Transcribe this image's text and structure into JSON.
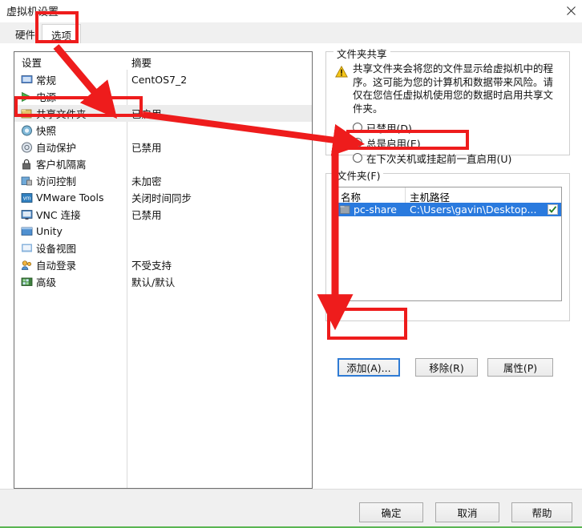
{
  "window": {
    "title": "虚拟机设置",
    "close_label": "✕"
  },
  "tabs": [
    {
      "label": "硬件",
      "active": false
    },
    {
      "label": "选项",
      "active": true
    }
  ],
  "settings_list": {
    "header": {
      "name": "设置",
      "summary": "摘要"
    },
    "rows": [
      {
        "label": "常规",
        "summary": "CentOS7_2",
        "icon": "monitor-icon",
        "selected": false
      },
      {
        "label": "电源",
        "summary": "",
        "icon": "play-icon",
        "selected": false
      },
      {
        "label": "共享文件夹",
        "summary": "已启用",
        "icon": "folder-icon",
        "selected": true
      },
      {
        "label": "快照",
        "summary": "",
        "icon": "camera-icon",
        "selected": false
      },
      {
        "label": "自动保护",
        "summary": "已禁用",
        "icon": "shield-circle-icon",
        "selected": false
      },
      {
        "label": "客户机隔离",
        "summary": "",
        "icon": "lock-icon",
        "selected": false
      },
      {
        "label": "访问控制",
        "summary": "未加密",
        "icon": "key-lock-icon",
        "selected": false
      },
      {
        "label": "VMware Tools",
        "summary": "关闭时间同步",
        "icon": "vm-icon",
        "selected": false
      },
      {
        "label": "VNC 连接",
        "summary": "已禁用",
        "icon": "display-icon",
        "selected": false
      },
      {
        "label": "Unity",
        "summary": "",
        "icon": "window-icon",
        "selected": false
      },
      {
        "label": "设备视图",
        "summary": "",
        "icon": "device-icon",
        "selected": false
      },
      {
        "label": "自动登录",
        "summary": "不受支持",
        "icon": "users-icon",
        "selected": false
      },
      {
        "label": "高级",
        "summary": "默认/默认",
        "icon": "grid-icon",
        "selected": false
      }
    ]
  },
  "folder_sharing": {
    "group_title": "文件夹共享",
    "warning_icon": "warning-triangle-icon",
    "warning_text": "共享文件夹会将您的文件显示给虚拟机中的程序。这可能为您的计算机和数据带来风险。请仅在您信任虚拟机使用您的数据时启用共享文件夹。",
    "options": [
      {
        "label": "已禁用(D)",
        "checked": false
      },
      {
        "label": "总是启用(E)",
        "checked": true
      },
      {
        "label": "在下次关机或挂起前一直启用(U)",
        "checked": false
      }
    ]
  },
  "folders": {
    "group_title": "文件夹(F)",
    "columns": [
      "名称",
      "主机路径"
    ],
    "rows": [
      {
        "name": "pc-share",
        "host_path": "C:\\Users\\gavin\\Desktop...",
        "enabled": true,
        "selected": true,
        "icon": "folder-small-icon"
      }
    ],
    "buttons": [
      {
        "label": "添加(A)...",
        "focused": true
      },
      {
        "label": "移除(R)",
        "focused": false
      },
      {
        "label": "属性(P)",
        "focused": false
      }
    ]
  },
  "footer": {
    "ok": "确定",
    "cancel": "取消",
    "help": "帮助"
  },
  "annotations": {
    "color": "#ee1c1c",
    "highlights": [
      "选项 tab",
      "共享文件夹 row",
      "总是启用(E) radio",
      "添加(A)... button"
    ]
  }
}
